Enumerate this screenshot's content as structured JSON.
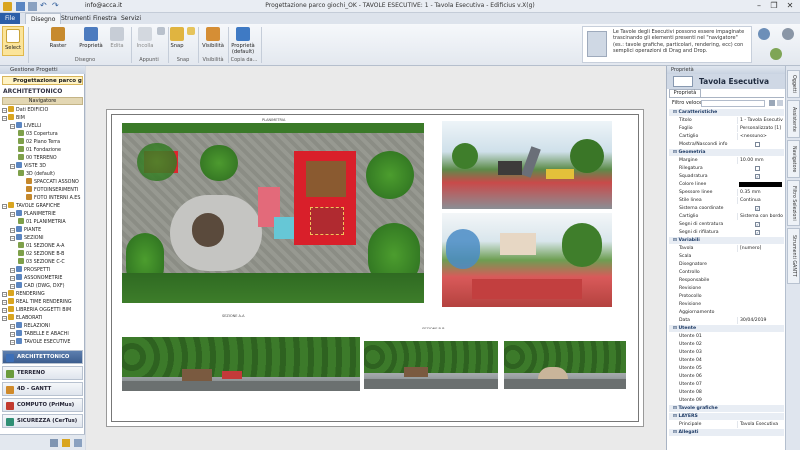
{
  "window": {
    "title": "Progettazione parco giochi_OK - TAVOLE ESECUTIVE: 1 - Tavola Esecutiva - Edificius v.X(g)",
    "user": "info@acca.it",
    "minimize": "–",
    "maximize": "❐",
    "close": "✕"
  },
  "tabs": [
    {
      "label": "File",
      "kind": "file"
    },
    {
      "label": "Disegno",
      "kind": "active"
    },
    {
      "label": "Strumenti",
      "kind": "normal"
    },
    {
      "label": "Finestra",
      "kind": "normal"
    },
    {
      "label": "Servizi",
      "kind": "normal"
    }
  ],
  "ribbon": {
    "select": "Select",
    "raster": "Raster",
    "proprieta": "Proprietà",
    "edita": "Edita",
    "incolla": "Incolla",
    "snap": "Snap",
    "visibilita": "Visibilità",
    "proprieta_default": "Proprietà (default)",
    "groups": [
      "Disegno",
      "Appunti",
      "Snap",
      "Visibilità",
      "Copia da..."
    ],
    "tip": "Le Tavole degli Esecutivi possono essere impaginate trascinando gli elementi presenti nel \"navigatore\" (es.: tavole grafiche, particolari, rendering, ecc) con semplici operazioni di Drag and Drop."
  },
  "left_panel": {
    "header": "Gestione Progetti",
    "project_tab": "Progettazione parco giochi",
    "section_title": "ARCHITETTONICO",
    "navigator_label": "Navigatore",
    "tree": [
      {
        "label": "Dati EDIFICIO",
        "level": 0
      },
      {
        "label": "BIM",
        "level": 0
      },
      {
        "label": "LIVELLI",
        "level": 1
      },
      {
        "label": "03 Copertura",
        "level": 2
      },
      {
        "label": "02 Piano Terra",
        "level": 2
      },
      {
        "label": "01 Fondazione",
        "level": 2
      },
      {
        "label": "00 TERRENO",
        "level": 2
      },
      {
        "label": "VISTE 3D",
        "level": 1
      },
      {
        "label": "3D (default)",
        "level": 2
      },
      {
        "label": "SPACCATI ASSONO",
        "level": 3
      },
      {
        "label": "FOTOINSERIMENTI",
        "level": 3
      },
      {
        "label": "FOTO INTERNI A.ES",
        "level": 3
      },
      {
        "label": "TAVOLE GRAFICHE",
        "level": 0
      },
      {
        "label": "PLANIMETRIE",
        "level": 1
      },
      {
        "label": "01 PLANIMETRIA",
        "level": 2
      },
      {
        "label": "PIANTE",
        "level": 1
      },
      {
        "label": "SEZIONI",
        "level": 1
      },
      {
        "label": "01 SEZIONE A-A",
        "level": 2
      },
      {
        "label": "02 SEZIONE B-B",
        "level": 2
      },
      {
        "label": "03 SEZIONE C-C",
        "level": 2
      },
      {
        "label": "PROSPETTI",
        "level": 1
      },
      {
        "label": "ASSONOMETRIE",
        "level": 1
      },
      {
        "label": "CAD (DWG, DXF)",
        "level": 1
      },
      {
        "label": "RENDERING",
        "level": 0
      },
      {
        "label": "REAL TIME RENDERING",
        "level": 0
      },
      {
        "label": "LIBRERIA OGGETTI BIM",
        "level": 0
      },
      {
        "label": "ELABORATI",
        "level": 0
      },
      {
        "label": "RELAZIONI",
        "level": 1
      },
      {
        "label": "TABELLE E ABACHI",
        "level": 1
      },
      {
        "label": "TAVOLE ESECUTIVE",
        "level": 1
      }
    ],
    "modules": [
      {
        "label": "ARCHITETTONICO",
        "color": "#3c6fb8",
        "active": true
      },
      {
        "label": "TERRENO",
        "color": "#6a9b3c",
        "active": false
      },
      {
        "label": "4D - GANTT",
        "color": "#d08a2a",
        "active": false
      },
      {
        "label": "COMPUTO (PriMus)",
        "color": "#c23a2e",
        "active": false
      },
      {
        "label": "SICUREZZA (CerTus)",
        "color": "#2f8f74",
        "active": false
      }
    ]
  },
  "canvas": {
    "plan_title": "PLANIMETRIA",
    "section_a": "SEZIONE A-A",
    "section_b": "SEZIONE B-B"
  },
  "right_panel": {
    "header": "Proprietà",
    "title": "Tavola Esecutiva",
    "tab": "Proprietà",
    "filter_label": "Filtro veloce",
    "rows": [
      {
        "type": "cat",
        "k": "Caratteristiche"
      },
      {
        "type": "row",
        "k": "Titolo",
        "v": "1 - Tavola Esecutiva"
      },
      {
        "type": "row",
        "k": "Foglio",
        "v": "Personalizzato [1]"
      },
      {
        "type": "row",
        "k": "Cartiglio",
        "v": "<nessuno>"
      },
      {
        "type": "check",
        "k": "Mostra/Nascondi info",
        "on": false
      },
      {
        "type": "cat",
        "k": "Geometria"
      },
      {
        "type": "row",
        "k": "Margine",
        "v": "10.00 mm"
      },
      {
        "type": "check",
        "k": "Rilegatura",
        "on": false
      },
      {
        "type": "check",
        "k": "Squadratura",
        "on": true
      },
      {
        "type": "color",
        "k": "Colore linee"
      },
      {
        "type": "row",
        "k": "Spessore linee",
        "v": "0.35 mm"
      },
      {
        "type": "row",
        "k": "Stile linea",
        "v": "Continua"
      },
      {
        "type": "check",
        "k": "Sistema coordinate",
        "on": true
      },
      {
        "type": "row",
        "k": "Cartiglio",
        "v": "Sistema con bordo"
      },
      {
        "type": "check",
        "k": "Segni di centratura",
        "on": true
      },
      {
        "type": "check",
        "k": "Segni di rifilatura",
        "on": true
      },
      {
        "type": "cat",
        "k": "Variabili"
      },
      {
        "type": "row",
        "k": "Tavola",
        "v": "[numero]"
      },
      {
        "type": "row",
        "k": "Scala",
        "v": ""
      },
      {
        "type": "row",
        "k": "Disegnatore",
        "v": ""
      },
      {
        "type": "row",
        "k": "Controllo",
        "v": ""
      },
      {
        "type": "row",
        "k": "Responsabile",
        "v": ""
      },
      {
        "type": "row",
        "k": "Revisione",
        "v": ""
      },
      {
        "type": "row",
        "k": "Protocollo",
        "v": ""
      },
      {
        "type": "row",
        "k": "Revisione",
        "v": ""
      },
      {
        "type": "row",
        "k": "Aggiornamento",
        "v": ""
      },
      {
        "type": "row",
        "k": "Data",
        "v": "30/04/2019"
      },
      {
        "type": "cat",
        "k": "Utente"
      },
      {
        "type": "row",
        "k": "Utente 01",
        "v": ""
      },
      {
        "type": "row",
        "k": "Utente 02",
        "v": ""
      },
      {
        "type": "row",
        "k": "Utente 03",
        "v": ""
      },
      {
        "type": "row",
        "k": "Utente 04",
        "v": ""
      },
      {
        "type": "row",
        "k": "Utente 05",
        "v": ""
      },
      {
        "type": "row",
        "k": "Utente 06",
        "v": ""
      },
      {
        "type": "row",
        "k": "Utente 07",
        "v": ""
      },
      {
        "type": "row",
        "k": "Utente 08",
        "v": ""
      },
      {
        "type": "row",
        "k": "Utente 09",
        "v": ""
      },
      {
        "type": "cat",
        "k": "Tavole grafiche"
      },
      {
        "type": "cat",
        "k": "LAYERS"
      },
      {
        "type": "row",
        "k": "Principale",
        "v": "Tavola Esecutiva"
      },
      {
        "type": "cat",
        "k": "Allegati"
      }
    ]
  },
  "side_tabs": [
    "Oggetti",
    "Assistente",
    "Navigatore",
    "Filtro Selezioni",
    "Strumenti GANTT"
  ]
}
